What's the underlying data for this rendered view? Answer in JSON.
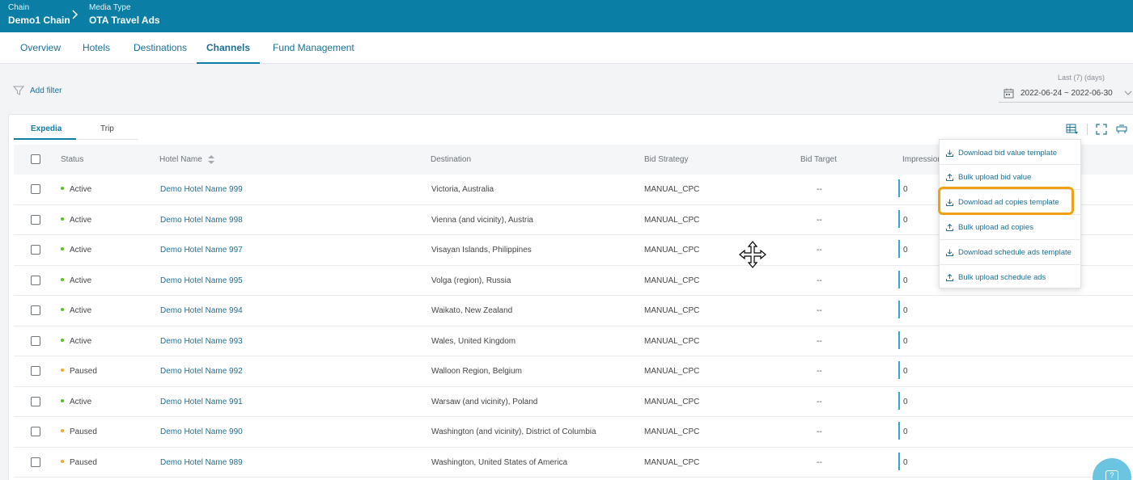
{
  "breadcrumb": [
    {
      "label": "Chain",
      "value": "Demo1 Chain"
    },
    {
      "label": "Media Type",
      "value": "OTA Travel Ads"
    }
  ],
  "nav_tabs": [
    "Overview",
    "Hotels",
    "Destinations",
    "Channels",
    "Fund Management"
  ],
  "active_nav_tab": "Channels",
  "filter": {
    "add_filter_label": "Add filter"
  },
  "date_range": {
    "label": "Last (7) (days)",
    "value": "2022-06-24 ~ 2022-06-30"
  },
  "channel_tabs": [
    "Expedia",
    "Trip"
  ],
  "active_channel_tab": "Expedia",
  "table": {
    "columns": [
      "Status",
      "Hotel Name",
      "Destination",
      "Bid Strategy",
      "Bid Target",
      "Impressions"
    ],
    "rows": [
      {
        "status": "Active",
        "hotel": "Demo Hotel Name 999",
        "destination": "Victoria, Australia",
        "bid_strategy": "MANUAL_CPC",
        "bid_target": "--",
        "impressions": "0"
      },
      {
        "status": "Active",
        "hotel": "Demo Hotel Name 998",
        "destination": "Vienna (and vicinity), Austria",
        "bid_strategy": "MANUAL_CPC",
        "bid_target": "--",
        "impressions": "0"
      },
      {
        "status": "Active",
        "hotel": "Demo Hotel Name 997",
        "destination": "Visayan Islands, Philippines",
        "bid_strategy": "MANUAL_CPC",
        "bid_target": "--",
        "impressions": "0"
      },
      {
        "status": "Active",
        "hotel": "Demo Hotel Name 995",
        "destination": "Volga (region), Russia",
        "bid_strategy": "MANUAL_CPC",
        "bid_target": "--",
        "impressions": "0"
      },
      {
        "status": "Active",
        "hotel": "Demo Hotel Name 994",
        "destination": "Waikato, New Zealand",
        "bid_strategy": "MANUAL_CPC",
        "bid_target": "--",
        "impressions": "0"
      },
      {
        "status": "Active",
        "hotel": "Demo Hotel Name 993",
        "destination": "Wales, United Kingdom",
        "bid_strategy": "MANUAL_CPC",
        "bid_target": "--",
        "impressions": "0"
      },
      {
        "status": "Paused",
        "hotel": "Demo Hotel Name 992",
        "destination": "Walloon Region, Belgium",
        "bid_strategy": "MANUAL_CPC",
        "bid_target": "--",
        "impressions": "0"
      },
      {
        "status": "Active",
        "hotel": "Demo Hotel Name 991",
        "destination": "Warsaw (and vicinity), Poland",
        "bid_strategy": "MANUAL_CPC",
        "bid_target": "--",
        "impressions": "0"
      },
      {
        "status": "Paused",
        "hotel": "Demo Hotel Name 990",
        "destination": "Washington (and vicinity), District of Columbia",
        "bid_strategy": "MANUAL_CPC",
        "bid_target": "--",
        "impressions": "0"
      },
      {
        "status": "Paused",
        "hotel": "Demo Hotel Name 989",
        "destination": "Washington, United States of America",
        "bid_strategy": "MANUAL_CPC",
        "bid_target": "--",
        "impressions": "0"
      }
    ]
  },
  "status_colors": {
    "Active": "#52c41a",
    "Paused": "#f5a623"
  },
  "bulk_menu": {
    "items": [
      {
        "label": "Download bid value template",
        "icon": "download-icon"
      },
      {
        "label": "Bulk upload bid value",
        "icon": "upload-icon"
      },
      {
        "label": "Download ad copies template",
        "icon": "download-icon"
      },
      {
        "label": "Bulk upload ad copies",
        "icon": "upload-icon"
      },
      {
        "label": "Download schedule ads template",
        "icon": "download-icon"
      },
      {
        "label": "Bulk upload schedule ads",
        "icon": "upload-icon"
      }
    ],
    "highlighted_index": 2
  },
  "colors": {
    "header": "#0a7ea4",
    "link": "#1b6f94",
    "highlight": "#f0a010"
  }
}
